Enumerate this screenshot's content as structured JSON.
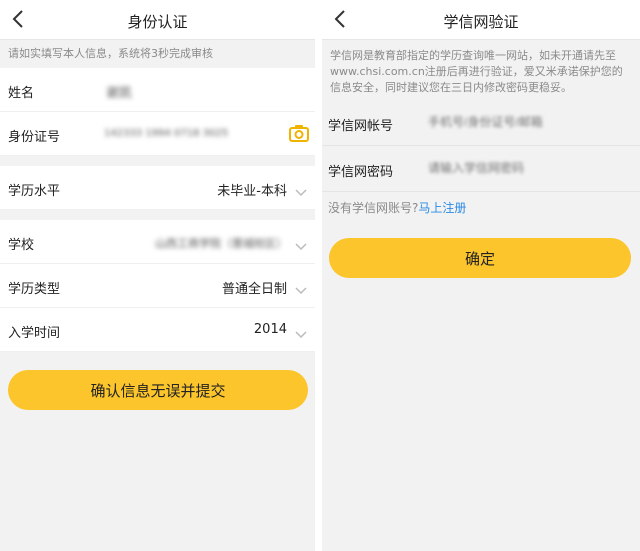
{
  "left": {
    "title": "身份认证",
    "notice": "请如实填写本人信息，系统将3秒完成审核",
    "fields": {
      "name": {
        "label": "姓名",
        "value": "谢凯"
      },
      "id_number": {
        "label": "身份证号",
        "value": "142333 1994 0718 3025"
      },
      "education_level": {
        "label": "学历水平",
        "value": "未毕业-本科"
      },
      "school": {
        "label": "学校",
        "value": "山西工商学院（晋城校区）"
      },
      "education_type": {
        "label": "学历类型",
        "value": "普通全日制"
      },
      "enrollment_year": {
        "label": "入学时间",
        "value": "2014"
      }
    },
    "submit_label": "确认信息无误并提交"
  },
  "right": {
    "title": "学信网验证",
    "notice": "学信网是教育部指定的学历查询唯一网站，如未开通请先至www.chsi.com.cn注册后再进行验证，爱又米承诺保护您的信息安全，同时建议您在三日内修改密码更稳妥。",
    "account": {
      "label": "学信网帐号",
      "placeholder": "手机号/身份证号/邮箱"
    },
    "password": {
      "label": "学信网密码",
      "placeholder": "请输入学信网密码"
    },
    "no_account_text": "没有学信网账号?",
    "register_link": "马上注册",
    "confirm_label": "确定"
  },
  "colors": {
    "accent": "#fbc52b",
    "link": "#2a8ae6",
    "background": "#f2f2f2"
  },
  "icons": [
    "back-arrow-icon",
    "camera-icon",
    "chevron-down-icon"
  ]
}
